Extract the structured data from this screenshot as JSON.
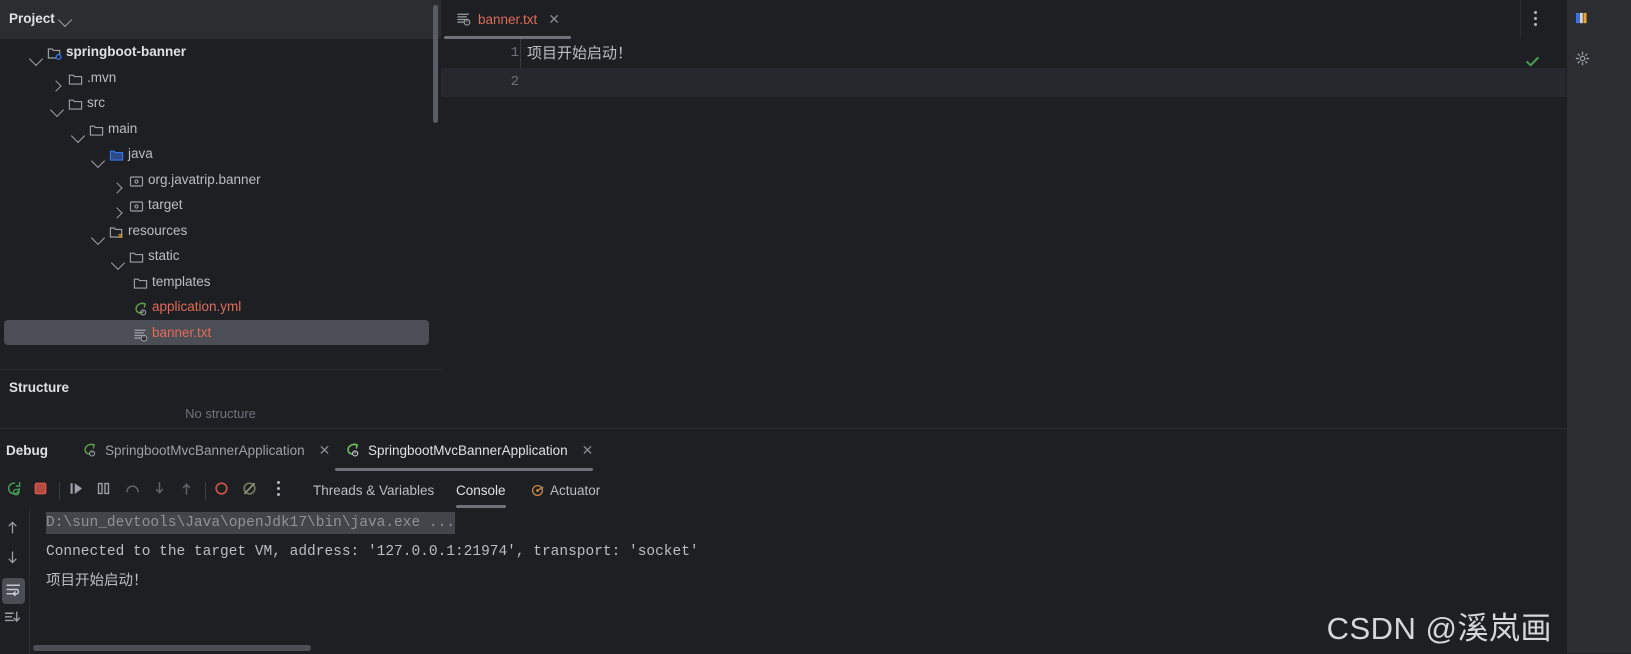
{
  "theme": {
    "bg": "#1e1f22",
    "header_bg": "#2b2d30",
    "selection_bg": "#4b4e55",
    "accent_red": "#e06c5a",
    "text": "#bcbec4",
    "text_bright": "#dfe1e5",
    "text_dim": "#6f737a",
    "green": "#499c54",
    "blue_folder": "#3574f0"
  },
  "project_panel": {
    "title": "Project",
    "chevron_icon": "chevron-down-icon",
    "tree": [
      {
        "label": "springboot-banner",
        "icon": "module-icon",
        "arrow": "chevron-down-icon",
        "depth": 0,
        "style": "bold",
        "selected": false
      },
      {
        "label": ".mvn",
        "icon": "folder-icon",
        "arrow": "chevron-right-icon",
        "depth": 1,
        "style": "normal",
        "selected": false
      },
      {
        "label": "src",
        "icon": "folder-icon",
        "arrow": "chevron-down-icon",
        "depth": 1,
        "style": "normal",
        "selected": false
      },
      {
        "label": "main",
        "icon": "folder-icon",
        "arrow": "chevron-down-icon",
        "depth": 2,
        "style": "normal",
        "selected": false
      },
      {
        "label": "java",
        "icon": "source-root-folder-icon",
        "arrow": "chevron-down-icon",
        "depth": 3,
        "style": "normal",
        "selected": false
      },
      {
        "label": "org.javatrip.banner",
        "icon": "package-icon",
        "arrow": "chevron-right-icon",
        "depth": 4,
        "style": "normal",
        "selected": false
      },
      {
        "label": "target",
        "icon": "package-icon",
        "arrow": "chevron-right-icon",
        "depth": 4,
        "style": "normal",
        "selected": false
      },
      {
        "label": "resources",
        "icon": "resource-root-folder-icon",
        "arrow": "chevron-down-icon",
        "depth": 3,
        "style": "normal",
        "selected": false
      },
      {
        "label": "static",
        "icon": "folder-icon",
        "arrow": "chevron-down-icon",
        "depth": 4,
        "style": "normal",
        "selected": false
      },
      {
        "label": "templates",
        "icon": "folder-icon",
        "arrow": "none",
        "depth": 5,
        "style": "normal",
        "selected": false
      },
      {
        "label": "application.yml",
        "icon": "spring-yaml-icon",
        "arrow": "none",
        "depth": 5,
        "style": "modified",
        "selected": false
      },
      {
        "label": "banner.txt",
        "icon": "text-file-icon",
        "arrow": "none",
        "depth": 5,
        "style": "modified",
        "selected": true
      }
    ]
  },
  "structure_panel": {
    "title": "Structure",
    "empty_text": "No structure"
  },
  "editor": {
    "tab": {
      "name": "banner.txt",
      "icon": "text-file-icon",
      "close_icon": "close-icon"
    },
    "more_icon": "more-vertical-icon",
    "inspection_status_icon": "check-ok-icon",
    "lines": [
      {
        "number": "1",
        "text": "项目开始启动！",
        "caret": false
      },
      {
        "number": "2",
        "text": "",
        "caret": true
      }
    ]
  },
  "right_strip": {
    "icons": [
      "maven-icon",
      "settings-icon"
    ]
  },
  "debug_panel": {
    "title": "Debug",
    "tabs": [
      {
        "label": "SpringbootMvcBannerApplication",
        "icon": "spring-boot-icon",
        "active": false,
        "close_icon": "close-icon"
      },
      {
        "label": "SpringbootMvcBannerApplication",
        "icon": "spring-boot-icon",
        "active": true,
        "close_icon": "close-icon"
      }
    ],
    "toolbar_icons": [
      "rerun-icon",
      "stop-icon",
      "resume-icon",
      "pause-icon",
      "step-over-icon",
      "step-into-icon",
      "step-out-icon",
      "view-breakpoints-icon",
      "mute-breakpoints-icon",
      "more-vertical-icon"
    ],
    "sub_tabs": [
      {
        "label": "Threads & Variables",
        "active": false,
        "icon": "none"
      },
      {
        "label": "Console",
        "active": true,
        "icon": "none"
      },
      {
        "label": "Actuator",
        "active": false,
        "icon": "actuator-icon"
      }
    ],
    "console_gutter_icons": [
      {
        "name": "scroll-up-icon",
        "active": false
      },
      {
        "name": "scroll-down-icon",
        "active": false
      },
      {
        "name": "soft-wrap-icon",
        "active": true
      },
      {
        "name": "scroll-to-end-icon",
        "active": false
      }
    ],
    "console_lines": [
      {
        "text": "D:\\sun_devtools\\Java\\openJdk17\\bin\\java.exe ...",
        "style": "selected"
      },
      {
        "text": "Connected to the target VM, address: '127.0.0.1:21974', transport: 'socket'",
        "style": "plain"
      },
      {
        "text": "项目开始启动！",
        "style": "cjk"
      }
    ]
  },
  "watermark": {
    "text": "CSDN @溪岚画"
  }
}
